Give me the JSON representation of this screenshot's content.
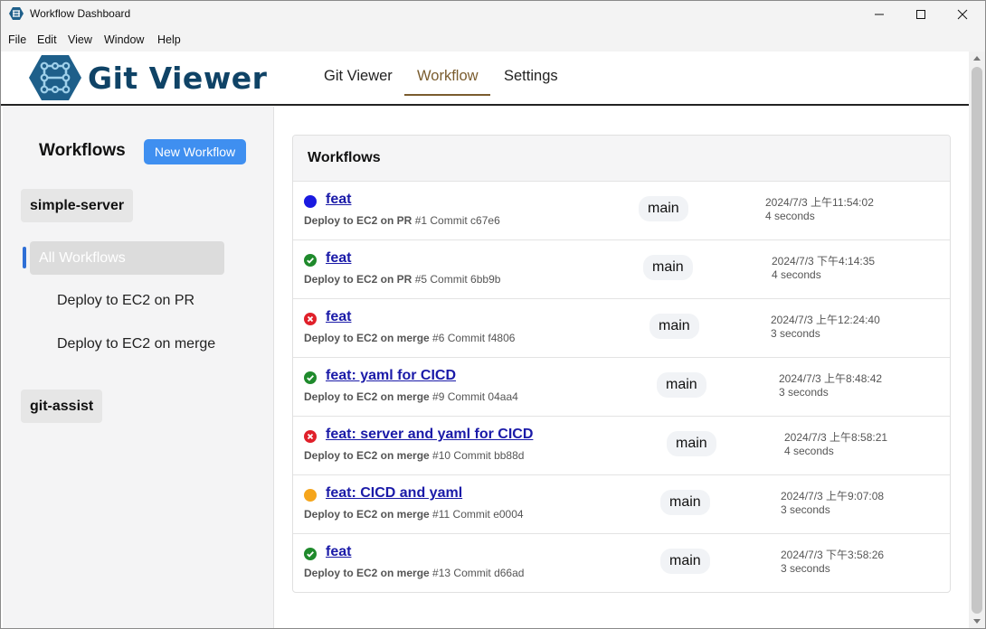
{
  "window": {
    "title": "Workflow Dashboard"
  },
  "menu": [
    "File",
    "Edit",
    "View",
    "Window",
    "Help"
  ],
  "header": {
    "logo_text": "Git Viewer",
    "tabs": [
      {
        "label": "Git Viewer",
        "active": false
      },
      {
        "label": "Workflow",
        "active": true
      },
      {
        "label": "Settings",
        "active": false
      }
    ]
  },
  "sidebar": {
    "title": "Workflows",
    "new_button": "New Workflow",
    "repos": [
      "simple-server",
      "git-assist"
    ],
    "selected_item": "All Workflows",
    "sub_items": [
      "Deploy to EC2 on PR",
      "Deploy to EC2 on merge"
    ]
  },
  "panel": {
    "title": "Workflows",
    "runs": [
      {
        "status": "in-progress",
        "status_color": "#1a1ae0",
        "title": "feat",
        "workflow": "Deploy to EC2 on PR",
        "number": "#1",
        "commit": "Commit c67e6",
        "branch": "main",
        "date": "2024/7/3 上午11:54:02",
        "duration": "4 seconds"
      },
      {
        "status": "success",
        "status_color": "#1f8a2c",
        "title": "feat",
        "workflow": "Deploy to EC2 on PR",
        "number": "#5",
        "commit": "Commit 6bb9b",
        "branch": "main",
        "date": "2024/7/3 下午4:14:35",
        "duration": "4 seconds"
      },
      {
        "status": "failure",
        "status_color": "#e0202a",
        "title": "feat",
        "workflow": "Deploy to EC2 on merge",
        "number": "#6",
        "commit": "Commit f4806",
        "branch": "main",
        "date": "2024/7/3 上午12:24:40",
        "duration": "3 seconds"
      },
      {
        "status": "success",
        "status_color": "#1f8a2c",
        "title": "feat: yaml for CICD",
        "workflow": "Deploy to EC2 on merge",
        "number": "#9",
        "commit": "Commit 04aa4",
        "branch": "main",
        "date": "2024/7/3 上午8:48:42",
        "duration": "3 seconds"
      },
      {
        "status": "failure",
        "status_color": "#e0202a",
        "title": "feat: server and yaml for CICD",
        "workflow": "Deploy to EC2 on merge",
        "number": "#10",
        "commit": "Commit bb88d",
        "branch": "main",
        "date": "2024/7/3 上午8:58:21",
        "duration": "4 seconds"
      },
      {
        "status": "queued",
        "status_color": "#f5a51c",
        "title": "feat: CICD and yaml",
        "workflow": "Deploy to EC2 on merge",
        "number": "#11",
        "commit": "Commit e0004",
        "branch": "main",
        "date": "2024/7/3 上午9:07:08",
        "duration": "3 seconds"
      },
      {
        "status": "success",
        "status_color": "#1f8a2c",
        "title": "feat",
        "workflow": "Deploy to EC2 on merge",
        "number": "#13",
        "commit": "Commit d66ad",
        "branch": "main",
        "date": "2024/7/3 下午3:58:26",
        "duration": "3 seconds"
      }
    ]
  }
}
